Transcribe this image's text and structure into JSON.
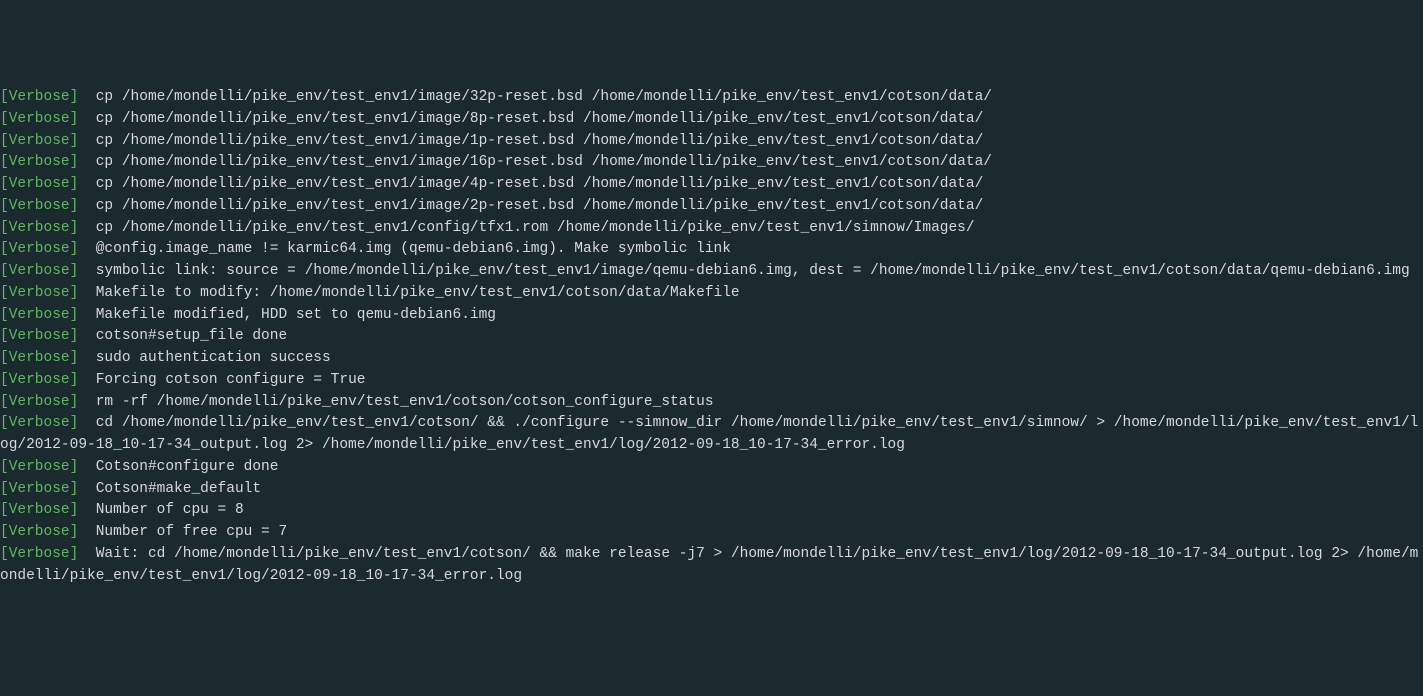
{
  "lines": [
    {
      "tag": "[Verbose]",
      "text": "  cp /home/mondelli/pike_env/test_env1/image/32p-reset.bsd /home/mondelli/pike_env/test_env1/cotson/data/"
    },
    {
      "tag": "[Verbose]",
      "text": "  cp /home/mondelli/pike_env/test_env1/image/8p-reset.bsd /home/mondelli/pike_env/test_env1/cotson/data/"
    },
    {
      "tag": "[Verbose]",
      "text": "  cp /home/mondelli/pike_env/test_env1/image/1p-reset.bsd /home/mondelli/pike_env/test_env1/cotson/data/"
    },
    {
      "tag": "[Verbose]",
      "text": "  cp /home/mondelli/pike_env/test_env1/image/16p-reset.bsd /home/mondelli/pike_env/test_env1/cotson/data/"
    },
    {
      "tag": "[Verbose]",
      "text": "  cp /home/mondelli/pike_env/test_env1/image/4p-reset.bsd /home/mondelli/pike_env/test_env1/cotson/data/"
    },
    {
      "tag": "[Verbose]",
      "text": "  cp /home/mondelli/pike_env/test_env1/image/2p-reset.bsd /home/mondelli/pike_env/test_env1/cotson/data/"
    },
    {
      "tag": "[Verbose]",
      "text": "  cp /home/mondelli/pike_env/test_env1/config/tfx1.rom /home/mondelli/pike_env/test_env1/simnow/Images/"
    },
    {
      "tag": "[Verbose]",
      "text": "  @config.image_name != karmic64.img (qemu-debian6.img). Make symbolic link"
    },
    {
      "tag": "[Verbose]",
      "text": "  symbolic link: source = /home/mondelli/pike_env/test_env1/image/qemu-debian6.img, dest = /home/mondelli/pike_env/test_env1/cotson/data/qemu-debian6.img"
    },
    {
      "tag": "[Verbose]",
      "text": "  Makefile to modify: /home/mondelli/pike_env/test_env1/cotson/data/Makefile"
    },
    {
      "tag": "[Verbose]",
      "text": "  Makefile modified, HDD set to qemu-debian6.img"
    },
    {
      "tag": "[Verbose]",
      "text": "  cotson#setup_file done"
    },
    {
      "tag": "[Verbose]",
      "text": "  sudo authentication success"
    },
    {
      "tag": "[Verbose]",
      "text": "  Forcing cotson configure = True"
    },
    {
      "tag": "[Verbose]",
      "text": "  rm -rf /home/mondelli/pike_env/test_env1/cotson/cotson_configure_status"
    },
    {
      "tag": "[Verbose]",
      "text": "  cd /home/mondelli/pike_env/test_env1/cotson/ && ./configure --simnow_dir /home/mondelli/pike_env/test_env1/simnow/ > /home/mondelli/pike_env/test_env1/log/2012-09-18_10-17-34_output.log 2> /home/mondelli/pike_env/test_env1/log/2012-09-18_10-17-34_error.log"
    },
    {
      "tag": "[Verbose]",
      "text": "  Cotson#configure done"
    },
    {
      "tag": "[Verbose]",
      "text": "  Cotson#make_default"
    },
    {
      "tag": "[Verbose]",
      "text": "  Number of cpu = 8"
    },
    {
      "tag": "[Verbose]",
      "text": "  Number of free cpu = 7"
    },
    {
      "tag": "[Verbose]",
      "text": "  Wait: cd /home/mondelli/pike_env/test_env1/cotson/ && make release -j7 > /home/mondelli/pike_env/test_env1/log/2012-09-18_10-17-34_output.log 2> /home/mondelli/pike_env/test_env1/log/2012-09-18_10-17-34_error.log"
    }
  ]
}
